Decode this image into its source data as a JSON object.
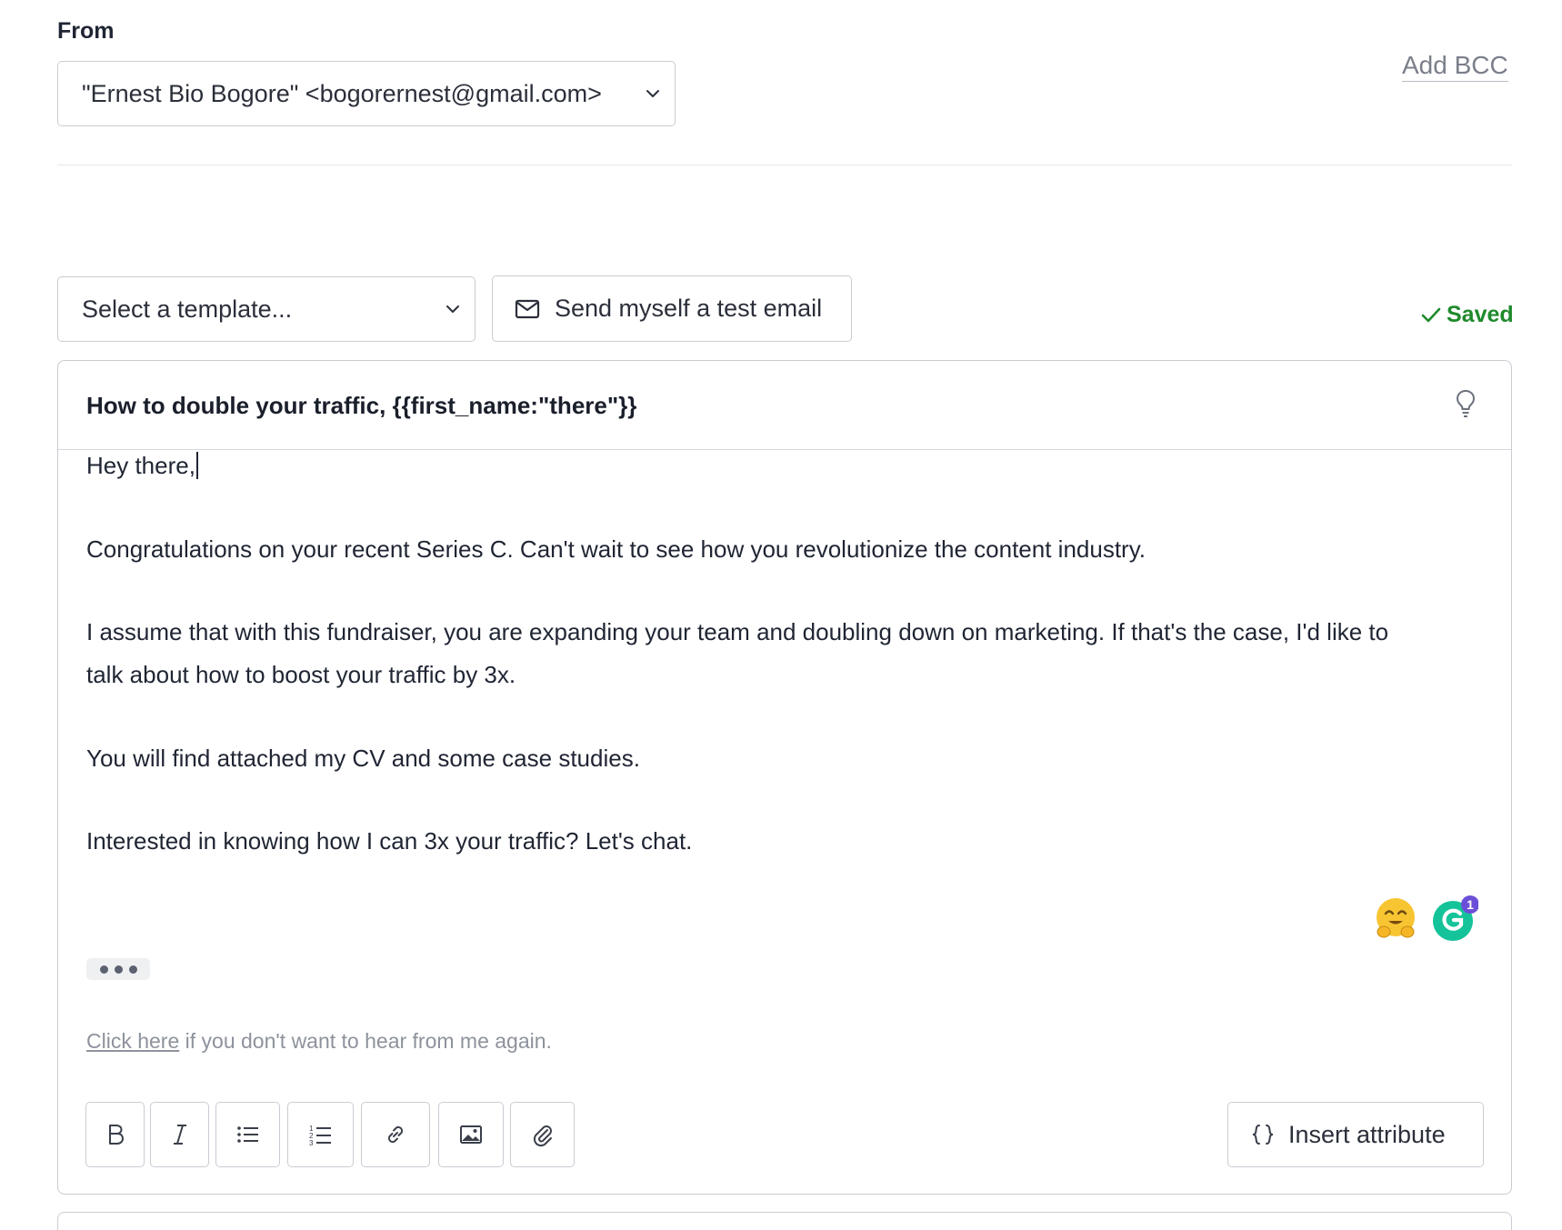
{
  "from": {
    "label": "From",
    "selected": "\"Ernest Bio Bogore\" <bogorernest@gmail.com>",
    "add_bcc": "Add BCC"
  },
  "toolbar_top": {
    "template_placeholder": "Select a template...",
    "test_email_label": "Send myself a test email",
    "saved_label": "Saved"
  },
  "editor": {
    "subject": "How to double your traffic, {{first_name:\"there\"}}",
    "body": {
      "greeting": "Hey there,",
      "p1": "Congratulations on your recent Series C. Can't wait to see how you revolutionize the content industry.",
      "p2_line1": "I assume that with this fundraiser, you are expanding your team and doubling down on marketing. If that's the case, I'd like to",
      "p2_line2": "talk about how to boost your traffic by 3x.",
      "p3": "You will find attached my CV and some case studies.",
      "p4": "Interested in knowing how I can 3x your traffic? Let's chat."
    },
    "unsubscribe": {
      "link": "Click here",
      "rest": " if you don't want to hear from me again."
    },
    "grammarly_badge": "1",
    "icons": [
      "lightbulb-icon",
      "hugging-face-emoji",
      "grammarly-icon"
    ]
  },
  "format_toolbar": {
    "tools": [
      "bold",
      "italic",
      "bullet-list",
      "numbered-list",
      "link",
      "image",
      "attachment"
    ],
    "insert_attribute_label": "Insert attribute"
  },
  "colors": {
    "saved_green": "#1f8a2c",
    "border": "#c9ccd2",
    "grammarly_green": "#15c39a",
    "badge_purple": "#6b4fd8"
  }
}
